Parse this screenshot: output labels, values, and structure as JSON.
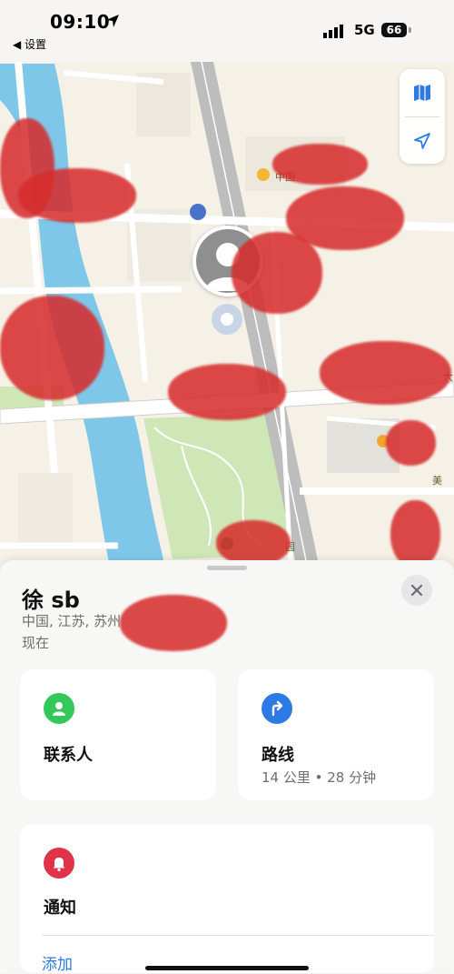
{
  "status_bar": {
    "time": "09:10",
    "back_label": "◀ 设置",
    "network": "5G",
    "battery": "66"
  },
  "map": {
    "labels": {
      "place_top": "中国",
      "road_right": "大",
      "place_lower_right": "美",
      "park": "园"
    },
    "controls": [
      "map-icon",
      "location-arrow-icon"
    ],
    "colors": {
      "water": "#7ec7e8",
      "park": "#cfe7b6",
      "road": "#bdbdbd",
      "land": "#f5f1e6"
    }
  },
  "sheet": {
    "name": "徐 sb",
    "location": "中国, 江苏, 苏州",
    "updated": "现在",
    "contact": {
      "label": "联系人",
      "icon": "person-icon",
      "color": "#34c759"
    },
    "route": {
      "label": "路线",
      "detail": "14 公里 • 28 分钟",
      "icon": "route-arrow-icon",
      "color": "#2c7be5"
    },
    "notifications": {
      "label": "通知",
      "icon": "bell-icon",
      "color": "#e0334a",
      "add_label": "添加"
    }
  }
}
